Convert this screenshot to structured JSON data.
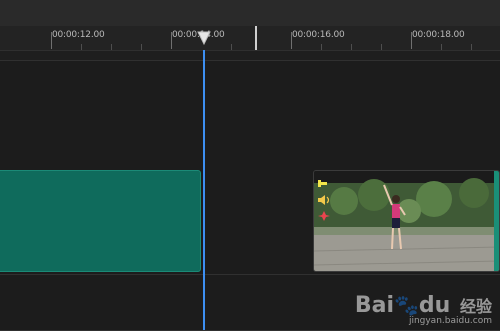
{
  "ruler": {
    "labels": [
      "00:00:12.00",
      "00:00:14.00",
      "00:00:16.00",
      "00:00:18.00"
    ]
  },
  "clips": {
    "audio_color": "#0f6b5c",
    "video_track_color": "#1a8f78",
    "video_icons": [
      "link-icon",
      "speaker-icon",
      "effects-icon"
    ]
  },
  "playhead": {
    "color": "#3d8ff2"
  },
  "watermark": {
    "brand": "Bai",
    "brand_suffix": "du",
    "product": "经验",
    "url": "jingyan.baidu.com"
  }
}
